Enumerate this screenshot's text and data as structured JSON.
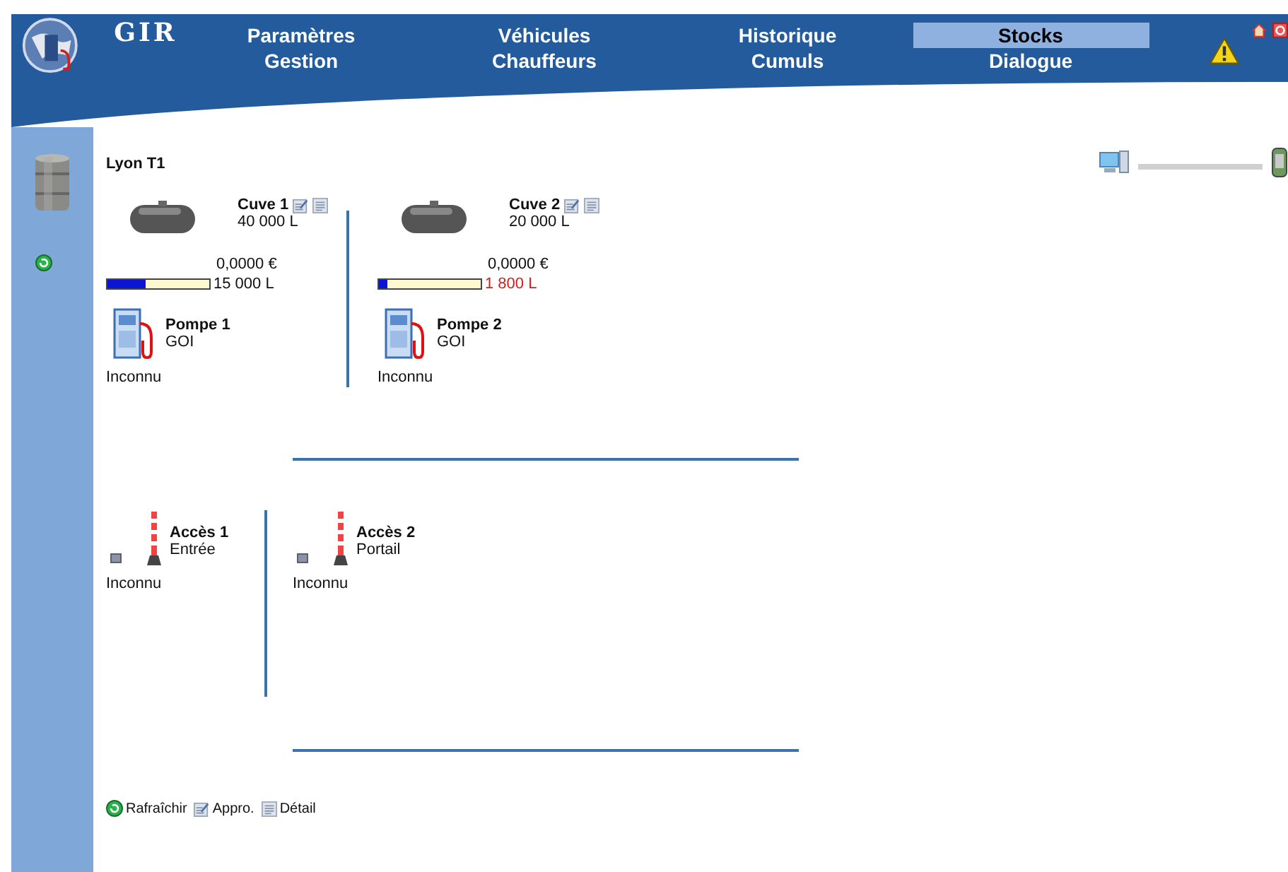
{
  "header": {
    "logo": "GIR",
    "nav": [
      {
        "links": [
          {
            "label": "Paramètres",
            "selected": false
          },
          {
            "label": "Gestion",
            "selected": false
          }
        ]
      },
      {
        "links": [
          {
            "label": "Véhicules",
            "selected": false
          },
          {
            "label": "Chauffeurs",
            "selected": false
          }
        ]
      },
      {
        "links": [
          {
            "label": "Historique",
            "selected": false
          },
          {
            "label": "Cumuls",
            "selected": false
          }
        ]
      },
      {
        "links": [
          {
            "label": "Stocks",
            "selected": true
          },
          {
            "label": "Dialogue",
            "selected": false
          }
        ]
      }
    ]
  },
  "site": {
    "title": "Lyon T1"
  },
  "tanks": [
    {
      "name": "Cuve 1",
      "capacity": "40 000 L",
      "price": "0,0000 €",
      "level": 0.38,
      "volume": "15 000 L",
      "low": false,
      "pump": {
        "name": "Pompe 1",
        "fuel": "GOI",
        "status": "Inconnu"
      }
    },
    {
      "name": "Cuve 2",
      "capacity": "20 000 L",
      "price": "0,0000 €",
      "level": 0.09,
      "volume": "1 800 L",
      "low": true,
      "pump": {
        "name": "Pompe 2",
        "fuel": "GOI",
        "status": "Inconnu"
      }
    }
  ],
  "accesses": [
    {
      "name": "Accès 1",
      "label": "Entrée",
      "status": "Inconnu"
    },
    {
      "name": "Accès 2",
      "label": "Portail",
      "status": "Inconnu"
    }
  ],
  "legend": [
    {
      "kind": "refresh",
      "label": "Rafraîchir"
    },
    {
      "kind": "edit",
      "label": "Appro."
    },
    {
      "kind": "detail",
      "label": "Détail"
    }
  ]
}
